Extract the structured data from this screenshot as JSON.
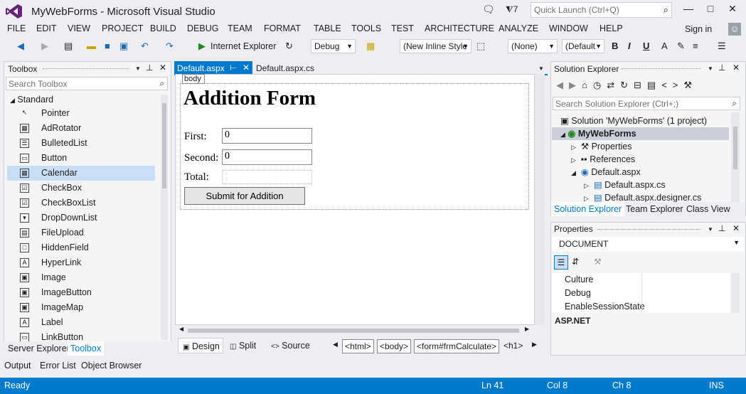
{
  "app": {
    "title": "MyWebForms - Microsoft Visual Studio",
    "notifications": "7",
    "quick_launch_placeholder": "Quick Launch (Ctrl+Q)"
  },
  "menu": [
    "FILE",
    "EDIT",
    "VIEW",
    "PROJECT",
    "BUILD",
    "DEBUG",
    "TEAM",
    "FORMAT",
    "TABLE",
    "TOOLS",
    "TEST",
    "ARCHITECTURE",
    "ANALYZE",
    "WINDOW",
    "HELP"
  ],
  "signin": "Sign in",
  "toolbar": {
    "browser": "Internet Explorer",
    "config": "Debug",
    "style": "(New Inline Style",
    "target": "(None)",
    "font": "(Default",
    "bold": "B",
    "italic": "I",
    "underline": "U"
  },
  "toolbox": {
    "title": "Toolbox",
    "search_placeholder": "Search Toolbox",
    "group": "Standard",
    "items": [
      "Pointer",
      "AdRotator",
      "BulletedList",
      "Button",
      "Calendar",
      "CheckBox",
      "CheckBoxList",
      "DropDownList",
      "FileUpload",
      "HiddenField",
      "HyperLink",
      "Image",
      "ImageButton",
      "ImageMap",
      "Label",
      "LinkButton"
    ],
    "selected": "Calendar",
    "tabs": [
      "Server Explorer",
      "Toolbox"
    ]
  },
  "editor": {
    "tabs": [
      "Default.aspx",
      "Default.aspx.cs"
    ],
    "body_tag": "body",
    "form": {
      "heading": "Addition Form",
      "first_label": "First:",
      "first_value": "0",
      "second_label": "Second:",
      "second_value": "0",
      "total_label": "Total:",
      "submit_label": "Submit for Addition"
    },
    "views": [
      "Design",
      "Split",
      "Source"
    ],
    "breadcrumbs": [
      "<html>",
      "<body>",
      "<form#frmCalculate>",
      "<h1>"
    ]
  },
  "solution_explorer": {
    "title": "Solution Explorer",
    "search_placeholder": "Search Solution Explorer (Ctrl+;)",
    "items": [
      {
        "label": "Solution 'MyWebForms' (1 project)"
      },
      {
        "label": "MyWebForms"
      },
      {
        "label": "Properties"
      },
      {
        "label": "References"
      },
      {
        "label": "Default.aspx"
      },
      {
        "label": "Default.aspx.cs"
      },
      {
        "label": "Default.aspx.designer.cs"
      }
    ],
    "tabs": [
      "Solution Explorer",
      "Team Explorer",
      "Class View"
    ]
  },
  "properties": {
    "title": "Properties",
    "object": "DOCUMENT",
    "rows": [
      "Culture",
      "Debug",
      "EnableSessionState"
    ],
    "category": "ASP.NET"
  },
  "bottom_tabs": [
    "Output",
    "Error List",
    "Object Browser"
  ],
  "status": {
    "ready": "Ready",
    "ln": "Ln 41",
    "col": "Col 8",
    "ch": "Ch 8",
    "mode": "INS"
  }
}
